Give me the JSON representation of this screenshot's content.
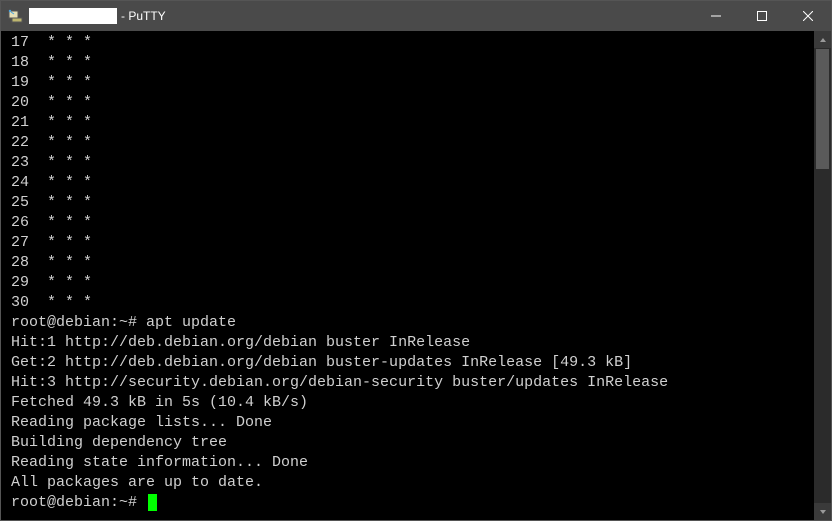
{
  "window": {
    "app_suffix": "- PuTTY"
  },
  "terminal": {
    "star_lines": [
      "17  * * *",
      "18  * * *",
      "19  * * *",
      "20  * * *",
      "21  * * *",
      "22  * * *",
      "23  * * *",
      "24  * * *",
      "25  * * *",
      "26  * * *",
      "27  * * *",
      "28  * * *",
      "29  * * *",
      "30  * * *"
    ],
    "prompt1": "root@debian:~# apt update",
    "out1": "Hit:1 http://deb.debian.org/debian buster InRelease",
    "out2": "Get:2 http://deb.debian.org/debian buster-updates InRelease [49.3 kB]",
    "out3": "Hit:3 http://security.debian.org/debian-security buster/updates InRelease",
    "out4": "Fetched 49.3 kB in 5s (10.4 kB/s)",
    "out5": "Reading package lists... Done",
    "out6": "Building dependency tree",
    "out7": "Reading state information... Done",
    "out8": "All packages are up to date.",
    "prompt2": "root@debian:~# "
  }
}
